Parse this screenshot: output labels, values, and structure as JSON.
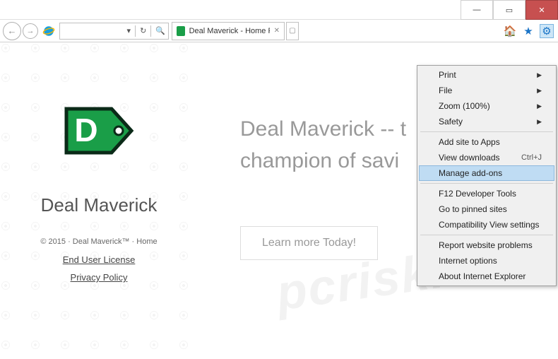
{
  "window": {
    "min": "—",
    "max": "▭",
    "close": "✕"
  },
  "toolbar": {
    "back": "←",
    "forward": "→",
    "refresh": "↻",
    "search": "🔍",
    "dropdown": "▾",
    "home": "🏠",
    "star": "★",
    "gear": "⚙"
  },
  "tab": {
    "title": "Deal Maverick - Home Page",
    "close": "✕"
  },
  "sidebar": {
    "logo_letter": "D",
    "brand": "Deal Maverick",
    "copyright": "© 2015 · Deal Maverick™ · Home",
    "links": [
      "End User License",
      "Privacy Policy"
    ]
  },
  "main": {
    "headline_line1": "Deal Maverick -- t",
    "headline_line2": "champion of savi",
    "cta": "Learn more Today!"
  },
  "menu": {
    "groups": [
      [
        {
          "label": "Print",
          "arrow": true
        },
        {
          "label": "File",
          "arrow": true
        },
        {
          "label": "Zoom (100%)",
          "arrow": true
        },
        {
          "label": "Safety",
          "arrow": true
        }
      ],
      [
        {
          "label": "Add site to Apps"
        },
        {
          "label": "View downloads",
          "shortcut": "Ctrl+J"
        },
        {
          "label": "Manage add-ons",
          "highlight": true
        }
      ],
      [
        {
          "label": "F12 Developer Tools"
        },
        {
          "label": "Go to pinned sites"
        },
        {
          "label": "Compatibility View settings"
        }
      ],
      [
        {
          "label": "Report website problems"
        },
        {
          "label": "Internet options"
        },
        {
          "label": "About Internet Explorer"
        }
      ]
    ]
  },
  "watermark": "pcrisk.com"
}
